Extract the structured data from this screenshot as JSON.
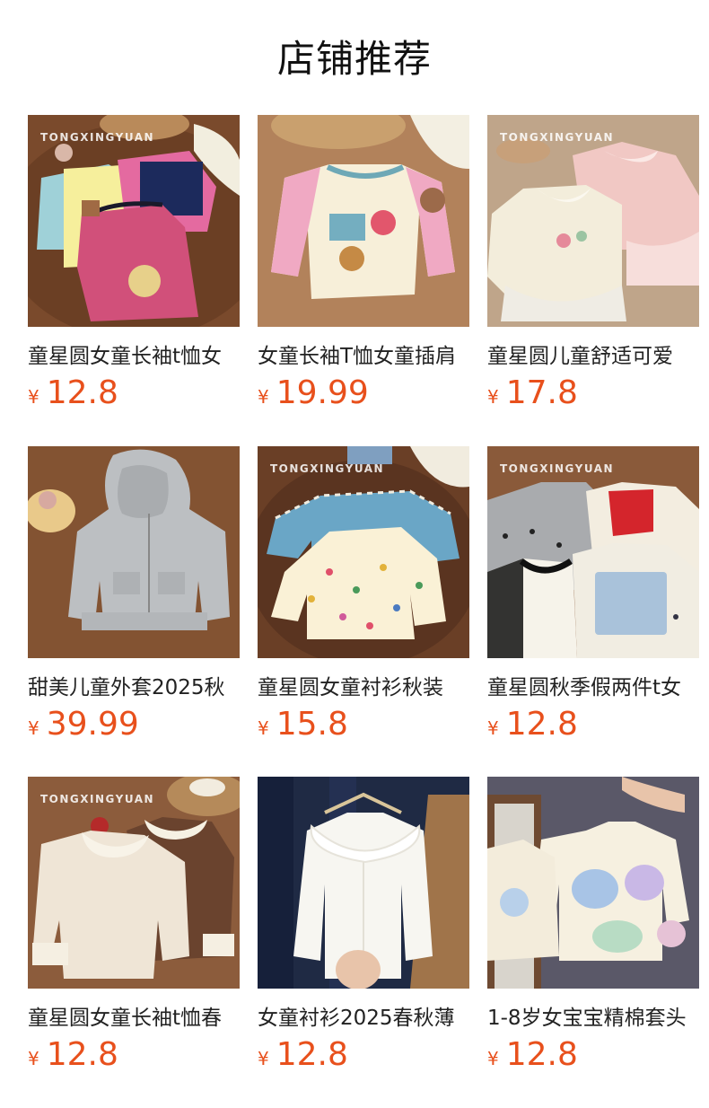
{
  "page": {
    "title": "店铺推荐"
  },
  "colors": {
    "price": "#e8501c",
    "text": "#222222"
  },
  "products": [
    {
      "name": "童星圆女童长袖t恤女",
      "currency": "¥",
      "price": "12.8",
      "watermark": "TONGXINGYUAN",
      "image": "three-kids-tops-with-bears"
    },
    {
      "name": "女童长袖T恤女童插肩",
      "currency": "¥",
      "price": "19.99",
      "watermark": "",
      "image": "pink-raglan-tee-with-cake-print"
    },
    {
      "name": "童星圆儿童舒适可爱",
      "currency": "¥",
      "price": "17.8",
      "watermark": "TONGXINGYUAN",
      "image": "ruffle-collar-tops-with-tulle"
    },
    {
      "name": "甜美儿童外套2025秋",
      "currency": "¥",
      "price": "39.99",
      "watermark": "",
      "image": "grey-zip-hoodie"
    },
    {
      "name": "童星圆女童衬衫秋装",
      "currency": "¥",
      "price": "15.8",
      "watermark": "TONGXINGYUAN",
      "image": "gingham-and-polka-dot-blouses"
    },
    {
      "name": "童星圆秋季假两件t女",
      "currency": "¥",
      "price": "12.8",
      "watermark": "TONGXINGYUAN",
      "image": "faux-two-piece-tees"
    },
    {
      "name": "童星圆女童长袖t恤春",
      "currency": "¥",
      "price": "12.8",
      "watermark": "TONGXINGYUAN",
      "image": "lace-collar-waffle-tops"
    },
    {
      "name": "女童衬衫2025春秋薄",
      "currency": "¥",
      "price": "12.8",
      "watermark": "",
      "image": "white-lace-collar-blouse"
    },
    {
      "name": "1-8岁女宝宝精棉套头",
      "currency": "¥",
      "price": "12.8",
      "watermark": "",
      "image": "cream-sweatshirt-with-floral-hearts"
    }
  ]
}
